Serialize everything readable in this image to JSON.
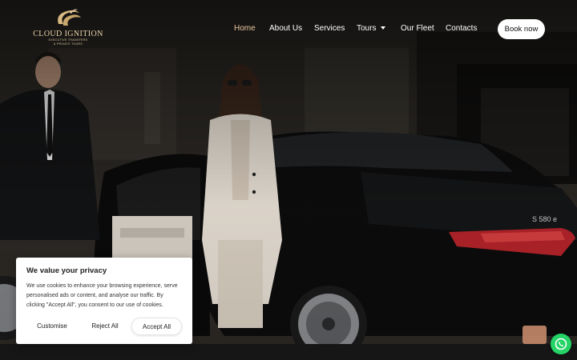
{
  "brand": {
    "name": "CLOUD IGNITION",
    "tagline_1": "EXECUTIVE TRANSFERS",
    "tagline_2": "& PRIVATE TOURS",
    "accent_color": "#e8c8a0"
  },
  "nav": {
    "items": [
      {
        "label": "Home",
        "active": true
      },
      {
        "label": "About Us"
      },
      {
        "label": "Services"
      },
      {
        "label": "Tours",
        "has_dropdown": true
      },
      {
        "label": "Our Fleet"
      },
      {
        "label": "Contacts"
      }
    ],
    "book_label": "Book now"
  },
  "hero": {
    "badge_text": "S 580 e"
  },
  "cookie": {
    "title": "We value your privacy",
    "text": "We use cookies to enhance your browsing experience, serve personalised ads or content, and analyse our traffic. By clicking \"Accept All\", you consent to our use of cookies.",
    "customise_label": "Customise",
    "reject_label": "Reject All",
    "accept_label": "Accept All"
  },
  "whatsapp": {
    "icon": "whatsapp-icon",
    "color": "#25d366"
  }
}
